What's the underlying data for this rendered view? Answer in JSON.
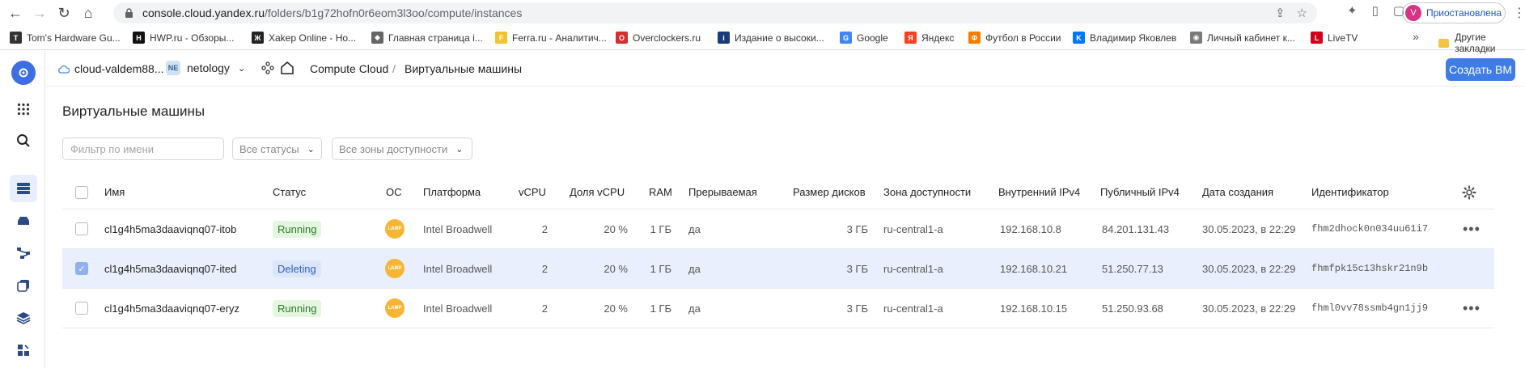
{
  "browser": {
    "url_host": "console.cloud.yandex.ru",
    "url_path": "/folders/b1g72hofn0r6eom3l3oo/compute/instances",
    "profile_initial": "V",
    "profile_label": "Приостановлена",
    "bookmarks": [
      {
        "label": "Tom's Hardware Gu...",
        "icon": "tom-icon",
        "color": "#333333",
        "glyph": "T"
      },
      {
        "label": "HWP.ru - Обзоры...",
        "icon": "hwp-icon",
        "color": "#111111",
        "glyph": "H"
      },
      {
        "label": "Xakep Online - Но...",
        "icon": "xakep-icon",
        "color": "#222222",
        "glyph": "Ж"
      },
      {
        "label": "Главная страница i...",
        "icon": "diamond-icon",
        "color": "#666666",
        "glyph": "◆"
      },
      {
        "label": "Ferra.ru - Аналитич...",
        "icon": "ferra-icon",
        "color": "#f2c230",
        "glyph": "F"
      },
      {
        "label": "Overclockers.ru",
        "icon": "overclockers-icon",
        "color": "#d32f2f",
        "glyph": "O"
      },
      {
        "label": "Издание о высоки...",
        "icon": "ixbt-icon",
        "color": "#1b3c7a",
        "glyph": "i"
      },
      {
        "label": "Google",
        "icon": "google-icon",
        "color": "#4285f4",
        "glyph": "G"
      },
      {
        "label": "Яндекс",
        "icon": "yandex-icon",
        "color": "#fc3f1d",
        "glyph": "Я"
      },
      {
        "label": "Футбол в России",
        "icon": "football-icon",
        "color": "#f57c00",
        "glyph": "Ф"
      },
      {
        "label": "Владимир Яковлев",
        "icon": "vk-icon",
        "color": "#0077ff",
        "glyph": "K"
      },
      {
        "label": "Личный кабинет к...",
        "icon": "cabinet-icon",
        "color": "#7a7a7a",
        "glyph": "◉"
      },
      {
        "label": "LiveTV",
        "icon": "livetv-icon",
        "color": "#d0021b",
        "glyph": "L"
      }
    ],
    "bookmarks_more": "»",
    "other_bookmarks": "Другие закладки"
  },
  "topbar": {
    "cloud": "cloud-valdem88...",
    "folder_badge": "NE",
    "folder": "netology",
    "service": "Compute Cloud",
    "separator": "/",
    "current": "Виртуальные машины",
    "create_button": "Создать ВМ"
  },
  "page": {
    "title": "Виртуальные машины",
    "filter_placeholder": "Фильтр по имени",
    "status_select": "Все статусы",
    "zone_select": "Все зоны доступности"
  },
  "table": {
    "columns": {
      "name": "Имя",
      "status": "Статус",
      "os": "ОС",
      "platform": "Платформа",
      "vcpu": "vCPU",
      "vcpu_share": "Доля vCPU",
      "ram": "RAM",
      "preemptible": "Прерываемая",
      "disk": "Размер дисков",
      "zone": "Зона доступности",
      "ipv4_int": "Внутренний IPv4",
      "ipv4_pub": "Публичный IPv4",
      "created": "Дата создания",
      "id": "Идентификатор"
    },
    "os_label": "LAMP",
    "rows": [
      {
        "name": "cl1g4h5ma3daaviqnq07-itob",
        "status": "Running",
        "platform": "Intel Broadwell",
        "vcpu": "2",
        "vcpu_share": "20 %",
        "ram": "1 ГБ",
        "preemptible": "да",
        "disk": "3 ГБ",
        "zone": "ru-central1-a",
        "ipv4_int": "192.168.10.8",
        "ipv4_pub": "84.201.131.43",
        "created": "30.05.2023, в 22:29",
        "id": "fhm2dhock0n034uu61i7",
        "selected": false
      },
      {
        "name": "cl1g4h5ma3daaviqnq07-ited",
        "status": "Deleting",
        "platform": "Intel Broadwell",
        "vcpu": "2",
        "vcpu_share": "20 %",
        "ram": "1 ГБ",
        "preemptible": "да",
        "disk": "3 ГБ",
        "zone": "ru-central1-a",
        "ipv4_int": "192.168.10.21",
        "ipv4_pub": "51.250.77.13",
        "created": "30.05.2023, в 22:29",
        "id": "fhmfpk15c13hskr21n9b",
        "selected": true
      },
      {
        "name": "cl1g4h5ma3daaviqnq07-eryz",
        "status": "Running",
        "platform": "Intel Broadwell",
        "vcpu": "2",
        "vcpu_share": "20 %",
        "ram": "1 ГБ",
        "preemptible": "да",
        "disk": "3 ГБ",
        "zone": "ru-central1-a",
        "ipv4_int": "192.168.10.15",
        "ipv4_pub": "51.250.93.68",
        "created": "30.05.2023, в 22:29",
        "id": "fhml0vv78ssmb4gn1jj9",
        "selected": false
      }
    ]
  },
  "colors": {
    "accent": "#3f7ce8",
    "running_bg": "#e5f6e0",
    "running_fg": "#2b7a25",
    "deleting_bg": "#dbe6fb",
    "deleting_fg": "#2f5fbf",
    "selected_row": "#e9effc"
  }
}
